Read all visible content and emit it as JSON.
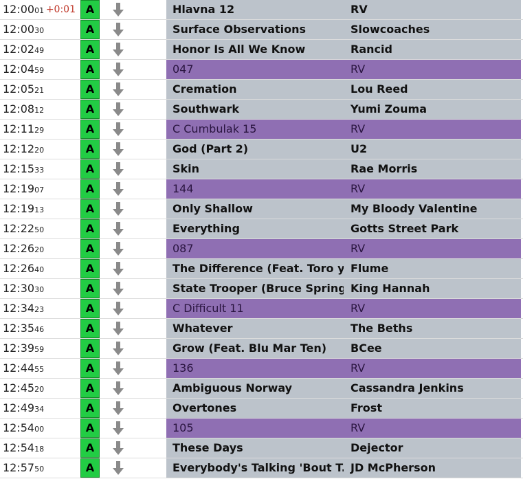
{
  "log": {
    "items": [
      {
        "time": "12:00",
        "sec": "01",
        "offset": "+0:01",
        "status": "A",
        "title": "Hlavna 12",
        "artist": "RV",
        "type": "song"
      },
      {
        "time": "12:00",
        "sec": "30",
        "offset": "",
        "status": "A",
        "title": "Surface Observations",
        "artist": "Slowcoaches",
        "type": "song"
      },
      {
        "time": "12:02",
        "sec": "49",
        "offset": "",
        "status": "A",
        "title": "Honor Is All We Know",
        "artist": "Rancid",
        "type": "song"
      },
      {
        "time": "12:04",
        "sec": "59",
        "offset": "",
        "status": "A",
        "title": "047",
        "artist": "RV",
        "type": "ad"
      },
      {
        "time": "12:05",
        "sec": "21",
        "offset": "",
        "status": "A",
        "title": "Cremation",
        "artist": "Lou Reed",
        "type": "song"
      },
      {
        "time": "12:08",
        "sec": "12",
        "offset": "",
        "status": "A",
        "title": "Southwark",
        "artist": "Yumi Zouma",
        "type": "song"
      },
      {
        "time": "12:11",
        "sec": "29",
        "offset": "",
        "status": "A",
        "title": "C Cumbulak 15",
        "artist": "RV",
        "type": "ad"
      },
      {
        "time": "12:12",
        "sec": "20",
        "offset": "",
        "status": "A",
        "title": "God (Part 2)",
        "artist": "U2",
        "type": "song"
      },
      {
        "time": "12:15",
        "sec": "33",
        "offset": "",
        "status": "A",
        "title": "Skin",
        "artist": "Rae Morris",
        "type": "song"
      },
      {
        "time": "12:19",
        "sec": "07",
        "offset": "",
        "status": "A",
        "title": "144",
        "artist": "RV",
        "type": "ad"
      },
      {
        "time": "12:19",
        "sec": "13",
        "offset": "",
        "status": "A",
        "title": "Only Shallow",
        "artist": "My Bloody Valentine",
        "type": "song"
      },
      {
        "time": "12:22",
        "sec": "50",
        "offset": "",
        "status": "A",
        "title": "Everything",
        "artist": "Gotts Street Park",
        "type": "song"
      },
      {
        "time": "12:26",
        "sec": "20",
        "offset": "",
        "status": "A",
        "title": "087",
        "artist": "RV",
        "type": "ad"
      },
      {
        "time": "12:26",
        "sec": "40",
        "offset": "",
        "status": "A",
        "title": "The Difference (Feat. Toro y ...",
        "artist": "Flume",
        "type": "song"
      },
      {
        "time": "12:30",
        "sec": "30",
        "offset": "",
        "status": "A",
        "title": "State Trooper (Bruce Spring...",
        "artist": "King Hannah",
        "type": "song"
      },
      {
        "time": "12:34",
        "sec": "23",
        "offset": "",
        "status": "A",
        "title": "C Difficult 11",
        "artist": "RV",
        "type": "ad"
      },
      {
        "time": "12:35",
        "sec": "46",
        "offset": "",
        "status": "A",
        "title": "Whatever",
        "artist": "The Beths",
        "type": "song"
      },
      {
        "time": "12:39",
        "sec": "59",
        "offset": "",
        "status": "A",
        "title": "Grow (Feat. Blu Mar Ten)",
        "artist": "BCee",
        "type": "song"
      },
      {
        "time": "12:44",
        "sec": "55",
        "offset": "",
        "status": "A",
        "title": "136",
        "artist": "RV",
        "type": "ad"
      },
      {
        "time": "12:45",
        "sec": "20",
        "offset": "",
        "status": "A",
        "title": "Ambiguous Norway",
        "artist": "Cassandra Jenkins",
        "type": "song"
      },
      {
        "time": "12:49",
        "sec": "34",
        "offset": "",
        "status": "A",
        "title": "Overtones",
        "artist": "Frost",
        "type": "song"
      },
      {
        "time": "12:54",
        "sec": "00",
        "offset": "",
        "status": "A",
        "title": "105",
        "artist": "RV",
        "type": "ad"
      },
      {
        "time": "12:54",
        "sec": "18",
        "offset": "",
        "status": "A",
        "title": "These Days",
        "artist": "Dejector",
        "type": "song"
      },
      {
        "time": "12:57",
        "sec": "50",
        "offset": "",
        "status": "A",
        "title": "Everybody's Talking 'Bout T...",
        "artist": "JD McPherson",
        "type": "song"
      }
    ]
  },
  "colors": {
    "status_green": "#22cc44",
    "row_gray": "#bcc3cb",
    "ad_purple": "#8f6fb3",
    "offset_red": "#c0392b",
    "arrow_gray": "#8a8a8a"
  },
  "icons": {
    "row_arrow": "arrow-down-icon"
  }
}
